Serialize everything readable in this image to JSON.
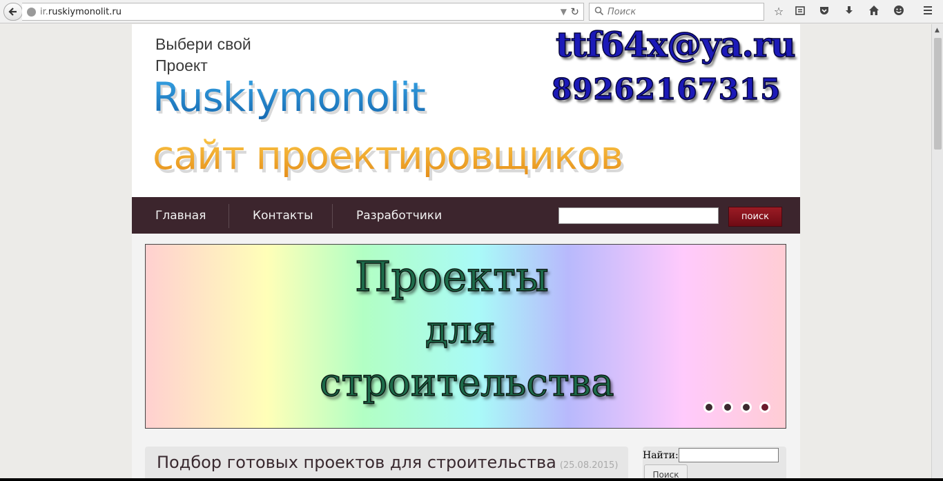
{
  "browser": {
    "url_prefix": "ir.",
    "url_domain": "ruskiymonolit.ru",
    "search_placeholder": "Поиск",
    "icons": [
      "back-arrow-icon",
      "globe-icon",
      "dropdown-arrow-icon",
      "reload-icon",
      "search-icon",
      "star-icon",
      "reading-list-icon",
      "pocket-icon",
      "download-icon",
      "home-icon",
      "smiley-icon",
      "menu-icon"
    ]
  },
  "header": {
    "tagline_line1": "Выбери свой",
    "tagline_line2": "Проект",
    "logo": "Ruskiymonolit",
    "slogan": "сайт проектировщиков",
    "email": "ttf64x@ya.ru",
    "phone": "89262167315"
  },
  "nav": {
    "items": [
      {
        "label": "Главная"
      },
      {
        "label": "Контакты"
      },
      {
        "label": "Разработчики"
      }
    ],
    "search_value": "",
    "search_button": "поиск"
  },
  "banner": {
    "lines": [
      "Проекты",
      "для",
      "строительства"
    ],
    "dots": 4,
    "active_dot": 4,
    "colors": {
      "text": "#1d6b4a",
      "dot": "#3d2a2f",
      "dot_active": "#6b1a2c"
    }
  },
  "content": {
    "title": "Подбор готовых проектов для строительства",
    "date": "(25.08.2015)"
  },
  "sidebar": {
    "find_label": "Найти:",
    "find_value": "",
    "find_button": "Поиск"
  },
  "colors": {
    "nav_bg": "#3c252d",
    "search_button": "#8a1520",
    "logo": "#1a7fc6",
    "slogan": "#f0a020",
    "contact": "#1c1ab8"
  }
}
